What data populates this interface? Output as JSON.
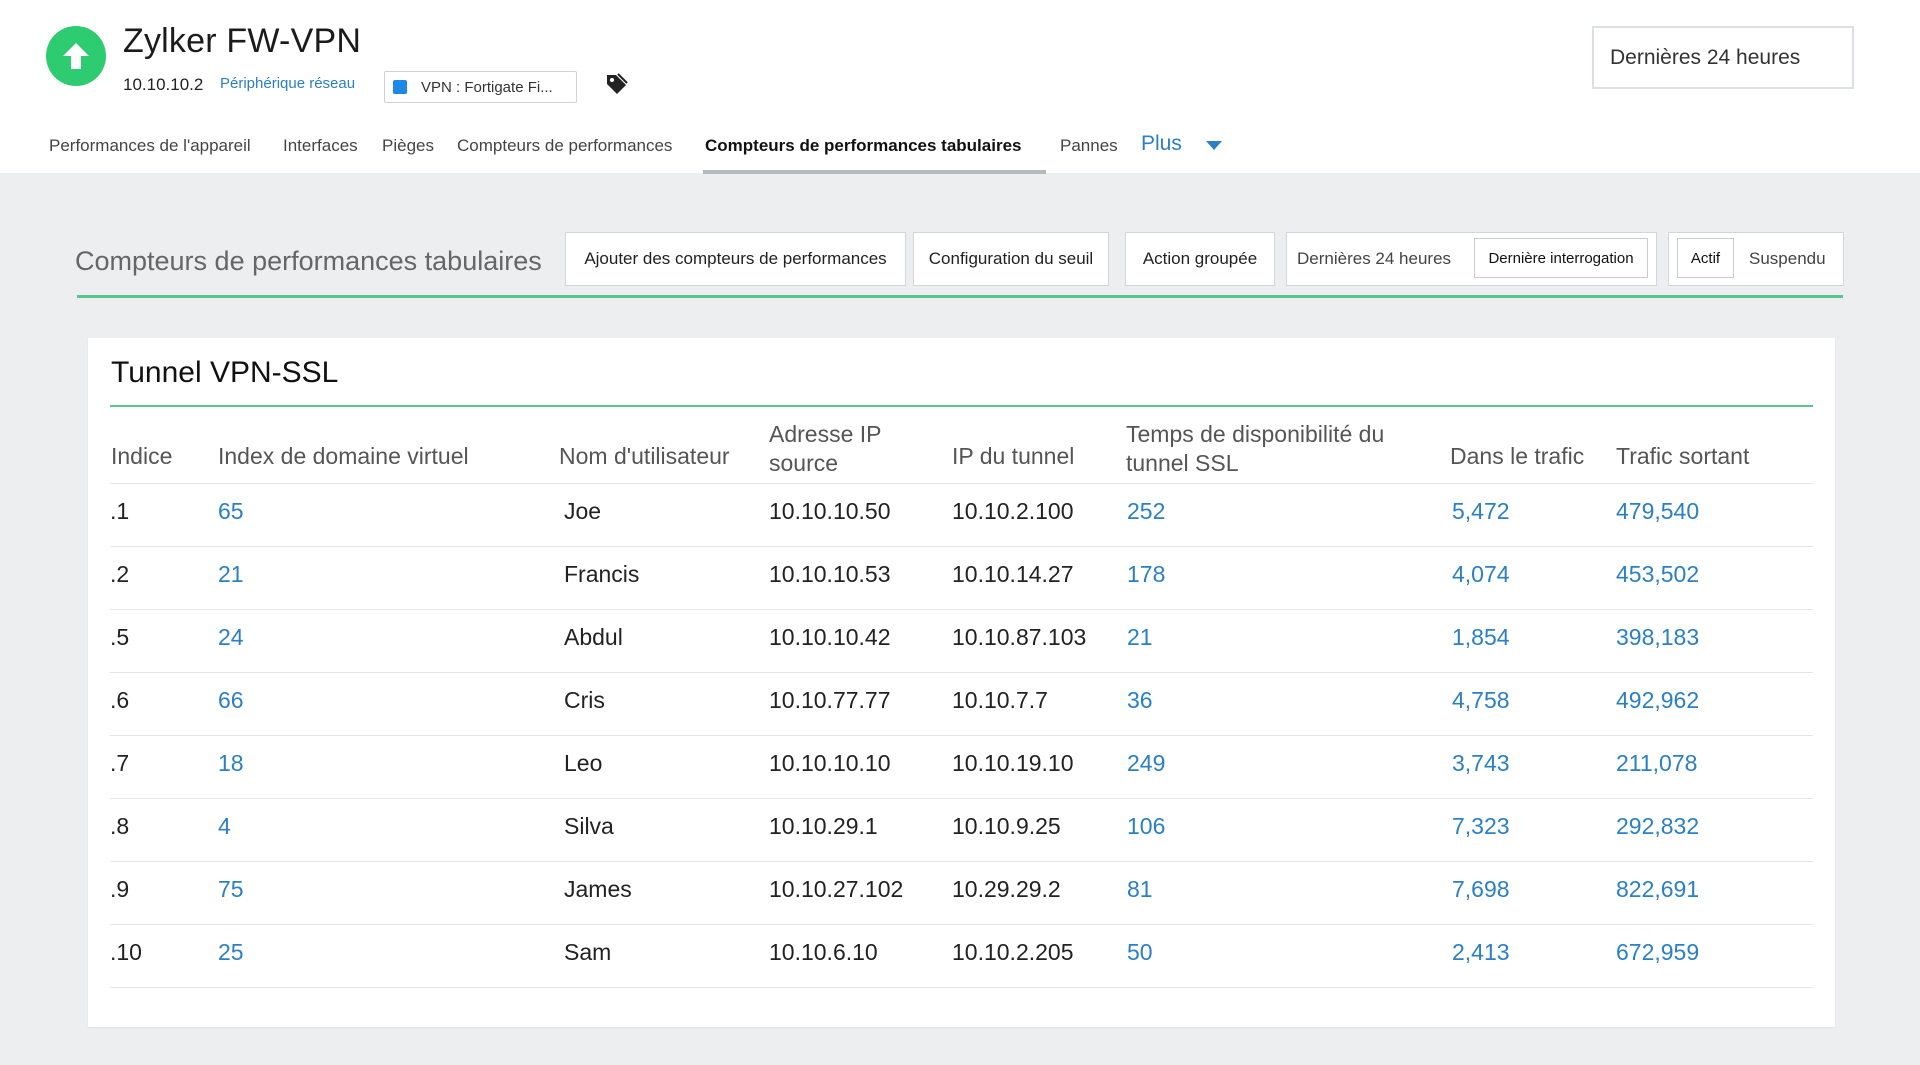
{
  "device": {
    "name": "Zylker FW-VPN",
    "ip": "10.10.10.2",
    "type": "Périphérique réseau",
    "vpn_label": "VPN : Fortigate Fi...",
    "status": "up",
    "status_color": "#2ecc71"
  },
  "time_range": "Dernières 24 heures",
  "tabs": [
    {
      "label": "Performances de l'appareil"
    },
    {
      "label": "Interfaces"
    },
    {
      "label": "Pièges"
    },
    {
      "label": "Compteurs de performances"
    },
    {
      "label": "Compteurs de performances tabulaires",
      "active": true
    },
    {
      "label": "Pannes"
    }
  ],
  "more_label": "Plus",
  "toolbar": {
    "title": "Compteurs de performances tabulaires",
    "add_counters": "Ajouter des compteurs de performances",
    "threshold_config": "Configuration du seuil",
    "bulk_action": "Action groupée",
    "range_options": [
      "Dernières 24 heures",
      "Dernière interrogation"
    ],
    "range_selected": "Dernière interrogation",
    "state_options": [
      "Actif",
      "Suspendu"
    ],
    "state_selected": "Actif"
  },
  "table": {
    "title": "Tunnel VPN-SSL",
    "columns": [
      "Indice",
      "Index de domaine virtuel",
      "Nom d'utilisateur",
      "Adresse IP source",
      "IP du tunnel",
      "Temps de disponibilité du tunnel SSL",
      "Dans le trafic",
      "Trafic sortant"
    ],
    "rows": [
      [
        ".1",
        "65",
        "Joe",
        "10.10.10.50",
        "10.10.2.100",
        "252",
        "5,472",
        "479,540"
      ],
      [
        ".2",
        "21",
        "Francis",
        "10.10.10.53",
        "10.10.14.27",
        "178",
        "4,074",
        "453,502"
      ],
      [
        ".5",
        "24",
        "Abdul",
        "10.10.10.42",
        "10.10.87.103",
        "21",
        "1,854",
        "398,183"
      ],
      [
        ".6",
        "66",
        "Cris",
        "10.10.77.77",
        "10.10.7.7",
        "36",
        "4,758",
        "492,962"
      ],
      [
        ".7",
        "18",
        "Leo",
        "10.10.10.10",
        "10.10.19.10",
        "249",
        "3,743",
        "211,078"
      ],
      [
        ".8",
        "4",
        "Silva",
        "10.10.29.1",
        "10.10.9.25",
        "106",
        "7,323",
        "292,832"
      ],
      [
        ".9",
        "75",
        "James",
        "10.10.27.102",
        "10.29.29.2",
        "81",
        "7,698",
        "822,691"
      ],
      [
        ".10",
        "25",
        "Sam",
        "10.10.6.10",
        "10.10.2.205",
        "50",
        "2,413",
        "672,959"
      ]
    ]
  },
  "colors": {
    "accent": "#2b7fc3",
    "success": "#2ecc71",
    "rule": "#5dc490"
  }
}
